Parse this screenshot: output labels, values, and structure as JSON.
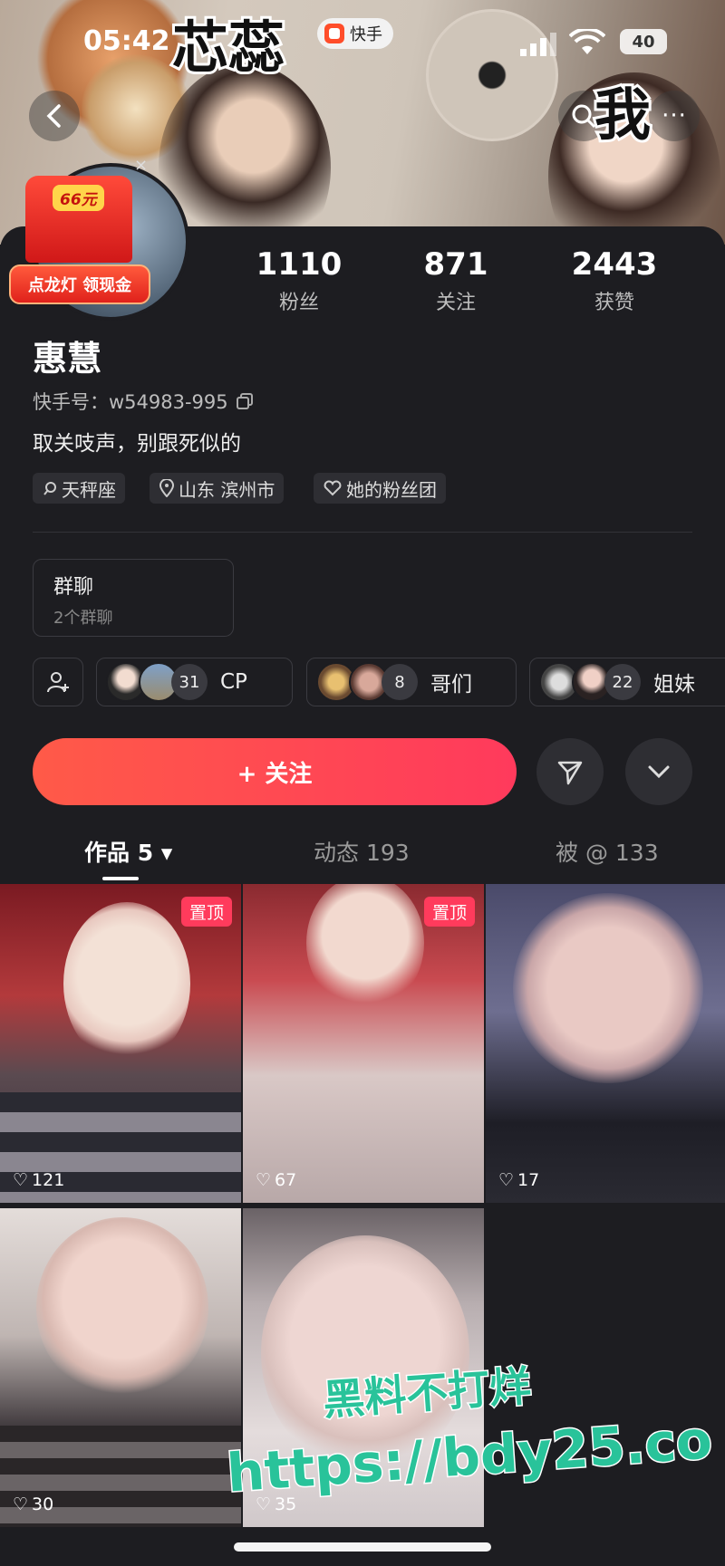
{
  "status_bar": {
    "time": "05:42",
    "battery": "40"
  },
  "app_badge": {
    "label": "快手"
  },
  "cover_overlay": {
    "left_text": "芯蕊",
    "right_text": "我"
  },
  "promo": {
    "amount": "66元",
    "label": "点龙灯 领现金"
  },
  "stats": [
    {
      "value": "1110",
      "label": "粉丝"
    },
    {
      "value": "871",
      "label": "关注"
    },
    {
      "value": "2443",
      "label": "获赞"
    }
  ],
  "profile": {
    "name": "惠慧",
    "id_label": "快手号：w54983-995",
    "bio": "取关吱声，别跟死似的",
    "tags": [
      "天秤座",
      "山东 滨州市",
      "她的粉丝团"
    ]
  },
  "group": {
    "title": "群聊",
    "subtitle": "2个群聊"
  },
  "relations": [
    {
      "count": "31",
      "label": "CP"
    },
    {
      "count": "8",
      "label": "哥们"
    },
    {
      "count": "22",
      "label": "姐妹"
    }
  ],
  "follow_button": {
    "label": "+ 关注"
  },
  "tabs": [
    {
      "label": "作品 5 ▾"
    },
    {
      "label": "动态 193"
    },
    {
      "label": "被 @ 133"
    }
  ],
  "videos": [
    {
      "likes": "121",
      "pinned": "置顶"
    },
    {
      "likes": "67",
      "pinned": "置顶"
    },
    {
      "likes": "17"
    },
    {
      "likes": "30"
    },
    {
      "likes": "35"
    }
  ],
  "watermark": {
    "line1": "黑料不打烊",
    "line2": "https://bdy25.co"
  },
  "colors": {
    "accent": "#ff4a55",
    "background": "#1d1d21",
    "watermark": "#29c39a"
  }
}
